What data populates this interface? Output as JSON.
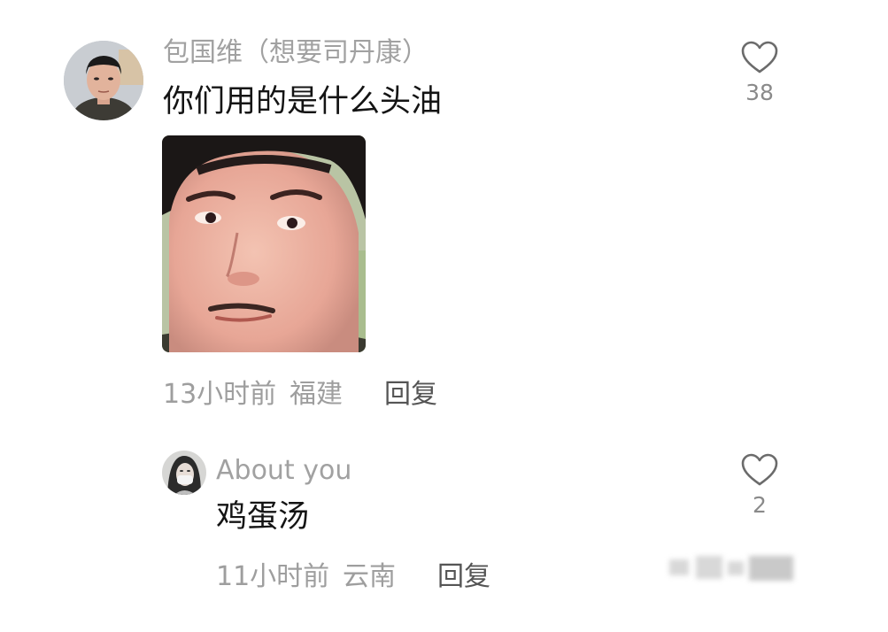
{
  "comment": {
    "username": "包国维（想要司丹康）",
    "text": "你们用的是什么头油",
    "time": "13小时前",
    "location": "福建",
    "reply_label": "回复",
    "likes": "38",
    "avatar_icon": "user-avatar-icon",
    "sticker_icon": "face-sticker-image"
  },
  "reply": {
    "username": "About you",
    "text": "鸡蛋汤",
    "time": "11小时前",
    "location": "云南",
    "reply_label": "回复",
    "likes": "2",
    "avatar_icon": "user-avatar-icon"
  },
  "icons": {
    "like": "heart-outline-icon"
  },
  "colors": {
    "username": "#a1a1a1",
    "text": "#141414",
    "meta": "#9e9e9e",
    "reply_button": "#555555",
    "like_icon": "#6b6b6b",
    "background": "#ffffff"
  }
}
